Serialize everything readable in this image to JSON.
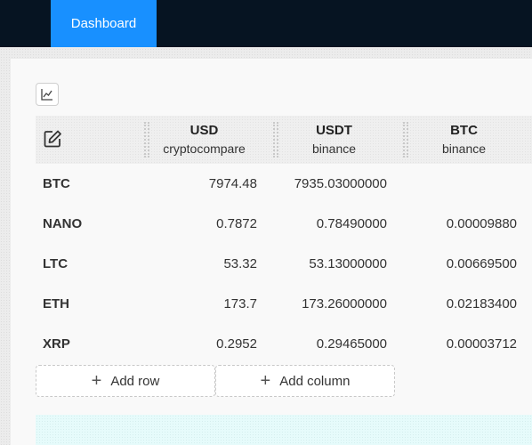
{
  "nav": {
    "active_tab": "Dashboard"
  },
  "toolbar": {
    "chart_toggle_icon": "line-chart-icon"
  },
  "table": {
    "edit_icon": "edit-icon",
    "columns": [
      {
        "currency": "USD",
        "source": "cryptocompare"
      },
      {
        "currency": "USDT",
        "source": "binance"
      },
      {
        "currency": "BTC",
        "source": "binance"
      }
    ],
    "rows": [
      {
        "symbol": "BTC",
        "values": [
          "7974.48",
          "7935.03000000",
          ""
        ]
      },
      {
        "symbol": "NANO",
        "values": [
          "0.7872",
          "0.78490000",
          "0.00009880"
        ]
      },
      {
        "symbol": "LTC",
        "values": [
          "53.32",
          "53.13000000",
          "0.00669500"
        ]
      },
      {
        "symbol": "ETH",
        "values": [
          "173.7",
          "173.26000000",
          "0.02183400"
        ]
      },
      {
        "symbol": "XRP",
        "values": [
          "0.2952",
          "0.29465000",
          "0.00003712"
        ]
      }
    ]
  },
  "actions": {
    "add_row": "Add row",
    "add_column": "Add column"
  },
  "colors": {
    "topbar": "#061422",
    "accent": "#1890ff",
    "alert": "#e6fbfb"
  }
}
